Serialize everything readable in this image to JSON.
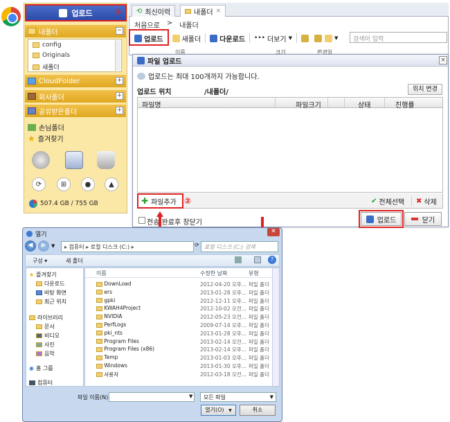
{
  "sidebar": {
    "upload_label": "업로드",
    "upload_number": "①",
    "my_folder": "내폴더",
    "tree_items": [
      "config",
      "Originals",
      "새폴더"
    ],
    "cloud_folder": "CloudFolder",
    "company_folder": "회사폴더",
    "shared_folder": "공유받은폴더",
    "guest_folder": "손님폴더",
    "favorites": "즐겨찾기",
    "storage": "507.4 GB / 755 GB"
  },
  "main": {
    "tabs": [
      {
        "label": "최신이력"
      },
      {
        "label": "내폴더"
      }
    ],
    "breadcrumb": [
      "처음으로",
      ">",
      "내폴더"
    ],
    "toolbar": {
      "upload": "업로드",
      "new_folder": "새폴더",
      "download": "다운로드",
      "more": "더보기",
      "search_placeholder": "검색어 입력"
    },
    "hidden_cols": [
      "이름",
      "크기",
      "변경일"
    ]
  },
  "upload_dialog": {
    "title": "파일 업로드",
    "note": "업로드는 최대 100개까지 가능합니다.",
    "location_label": "업로드 위치",
    "location_value": "/내폴더/",
    "change_location": "위치 변경",
    "columns": [
      "파일명",
      "파일크기",
      "상태",
      "진행률"
    ],
    "add_file": "파일추가",
    "add_file_number": "②",
    "select_all": "전체선택",
    "delete": "삭제",
    "close_after": "전송 완료후 창닫기",
    "upload_btn": "업로드",
    "close_btn": "닫기"
  },
  "open_dialog": {
    "title": "열기",
    "address": [
      "컴퓨터",
      "로컬 디스크 (C:)"
    ],
    "search_placeholder": "로컬 디스크 (C:) 검색",
    "organize": "구성 ▾",
    "new_folder": "새 폴더",
    "nav": [
      "즐겨찾기",
      "다운로드",
      "바탕 화면",
      "최근 위치",
      "라이브러리",
      "문서",
      "비디오",
      "사진",
      "음악",
      "홈 그룹",
      "컴퓨터"
    ],
    "columns": [
      "이름",
      "수정한 날짜",
      "유형"
    ],
    "files": [
      {
        "name": "DownLoad",
        "date": "2012-04-20 오후...",
        "type": "파일 폴더"
      },
      {
        "name": "ers",
        "date": "2013-01-28 오후...",
        "type": "파일 폴더"
      },
      {
        "name": "gpki",
        "date": "2012-12-11 오후...",
        "type": "파일 폴더"
      },
      {
        "name": "KWAH4Project",
        "date": "2012-10-02 오전...",
        "type": "파일 폴더"
      },
      {
        "name": "NVIDIA",
        "date": "2012-05-23 오전...",
        "type": "파일 폴더"
      },
      {
        "name": "PerfLogs",
        "date": "2009-07-14 오후...",
        "type": "파일 폴더"
      },
      {
        "name": "pki_nts",
        "date": "2013-01-28 오후...",
        "type": "파일 폴더"
      },
      {
        "name": "Program Files",
        "date": "2013-02-14 오전...",
        "type": "파일 폴더"
      },
      {
        "name": "Program Files (x86)",
        "date": "2013-02-14 오후...",
        "type": "파일 폴더"
      },
      {
        "name": "Temp",
        "date": "2013-01-03 오후...",
        "type": "파일 폴더"
      },
      {
        "name": "Windows",
        "date": "2013-01-30 오후...",
        "type": "파일 폴더"
      },
      {
        "name": "사용자",
        "date": "2012-03-18 오전...",
        "type": "파일 폴더"
      }
    ],
    "filename_label": "파일 이름(N):",
    "filetype_value": "모든 파일",
    "open_btn": "열기(O)",
    "cancel_btn": "취소"
  },
  "colors": {
    "accent_red": "#e02020",
    "sidebar_yellow": "#fbe7a6",
    "upload_blue": "#2b4aa8"
  }
}
